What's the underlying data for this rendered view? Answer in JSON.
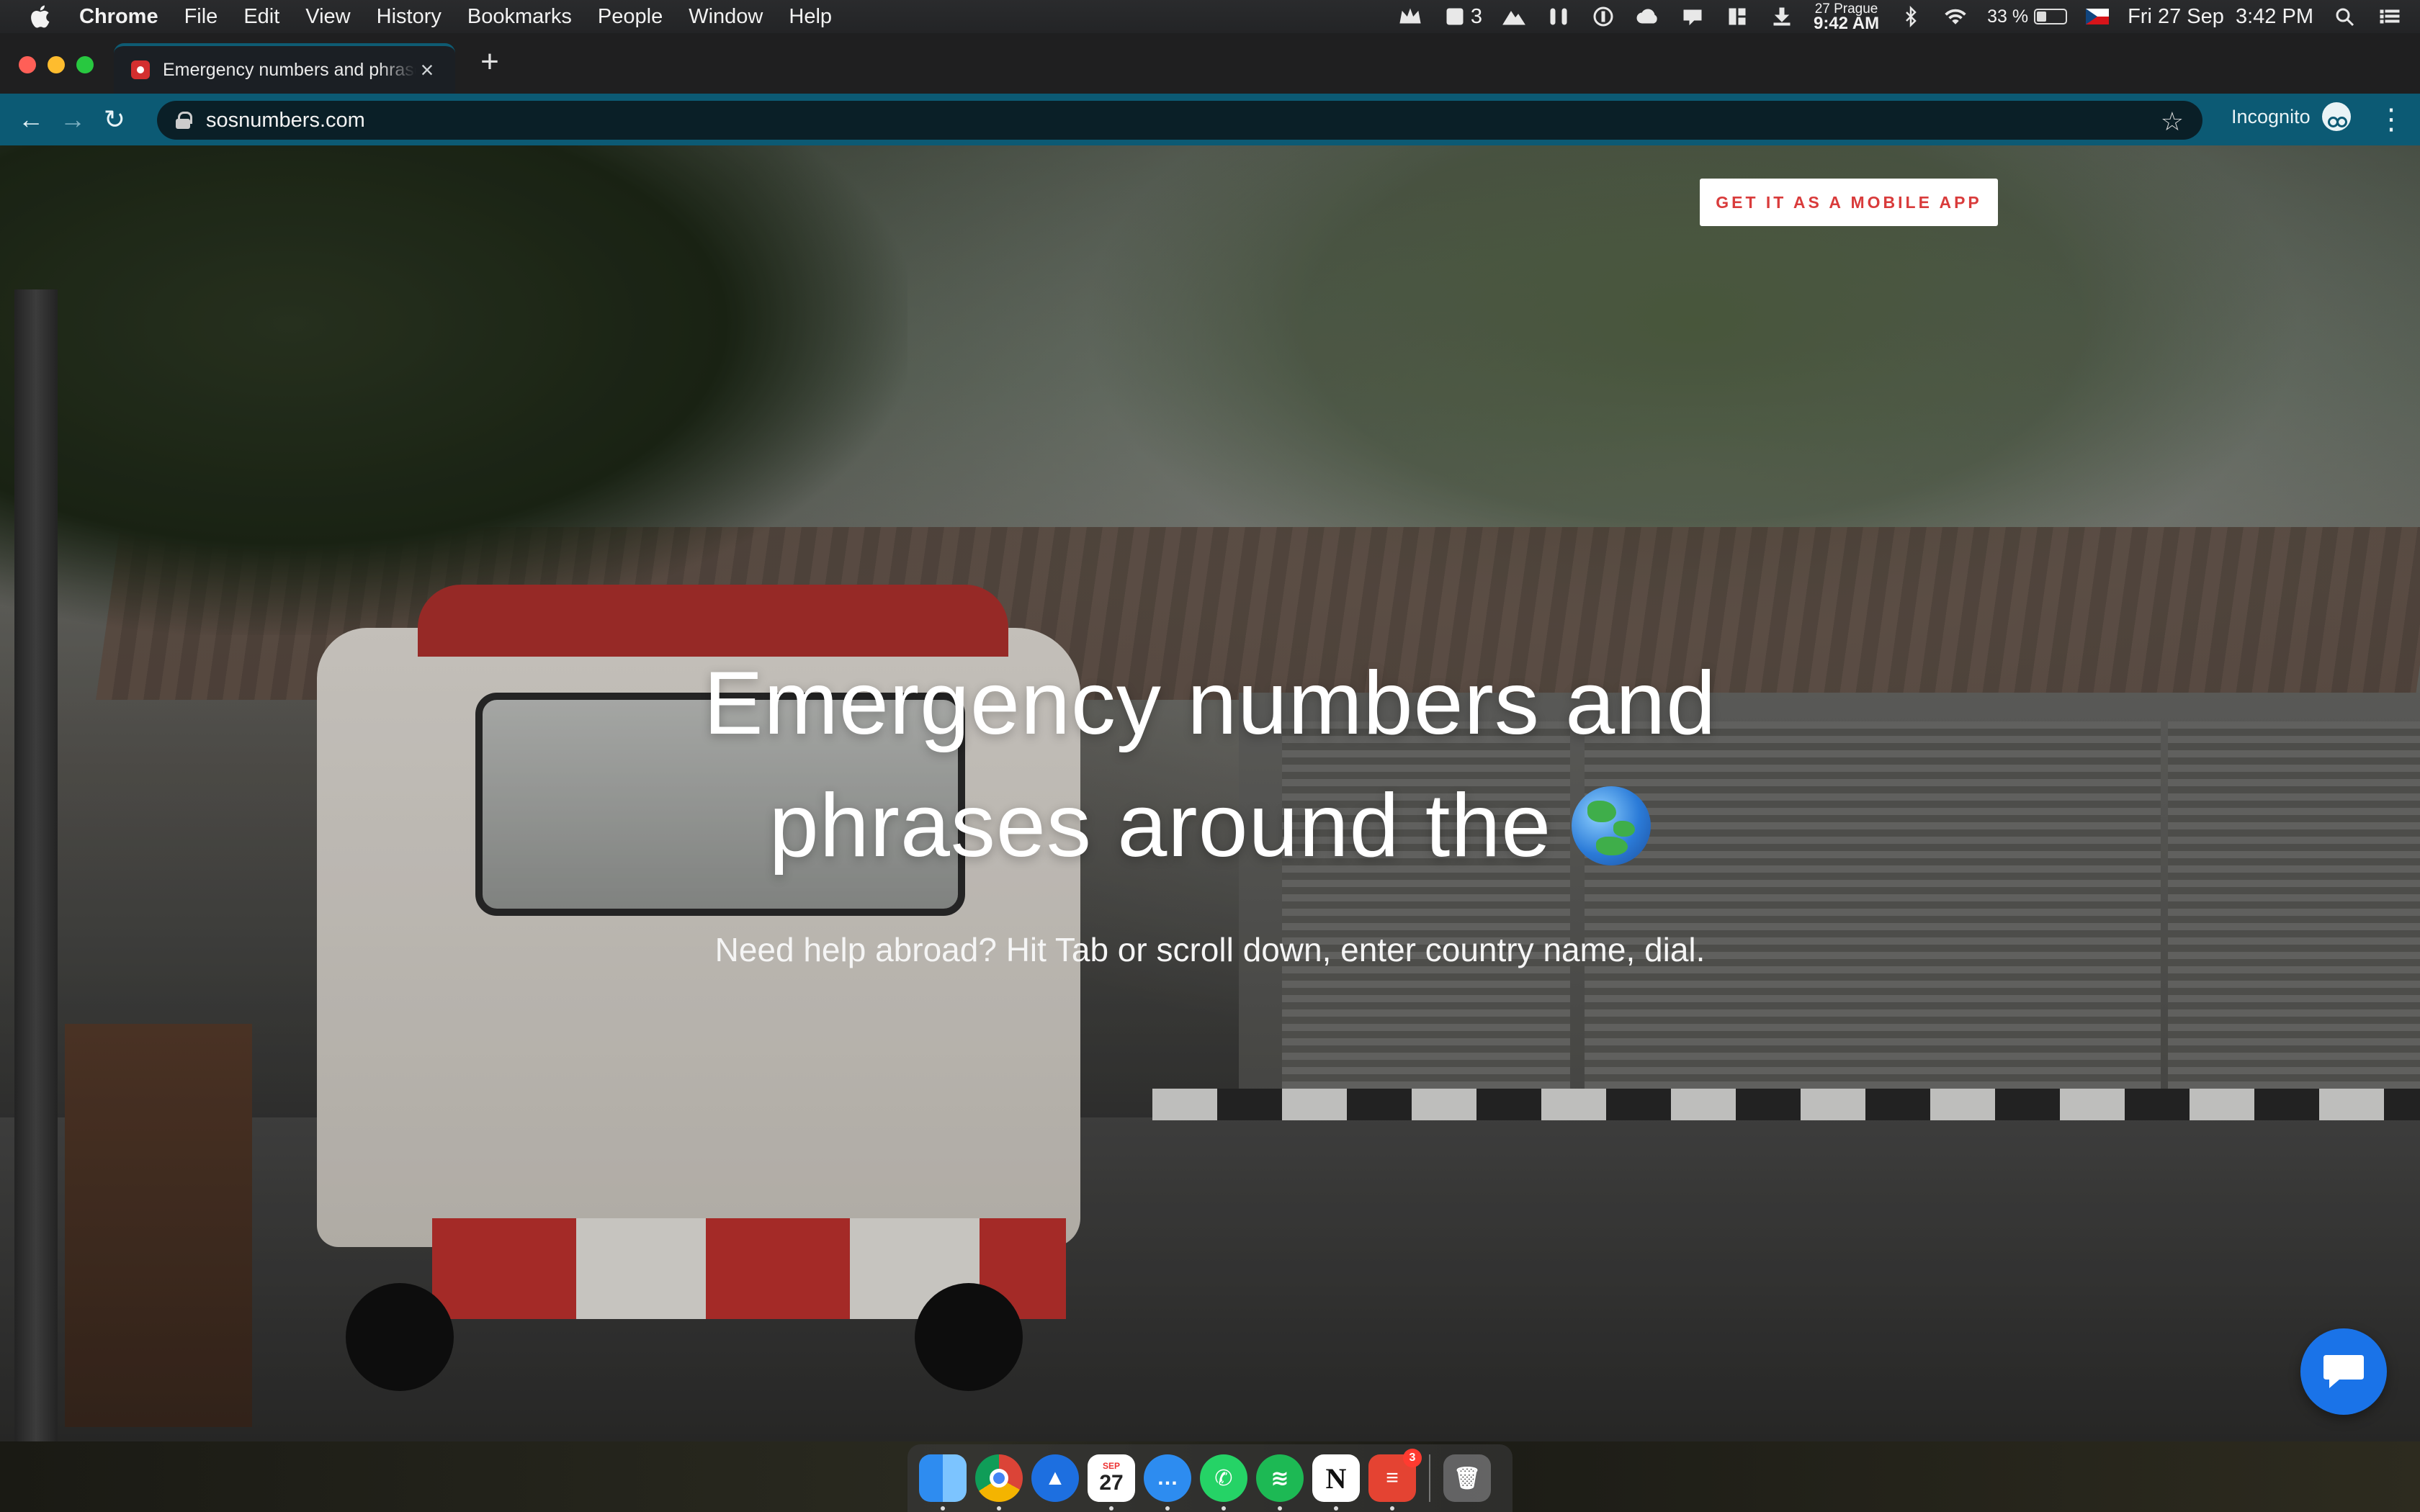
{
  "menubar": {
    "app": "Chrome",
    "items": [
      "File",
      "Edit",
      "View",
      "History",
      "Bookmarks",
      "People",
      "Window",
      "Help"
    ],
    "status": {
      "crown_count": "3",
      "world_clock_top": "27 Prague",
      "world_clock_bottom": "9:42 AM",
      "battery": "33 %",
      "battery_level": 0.33,
      "datetime": "Fri 27 Sep  3:42 PM"
    }
  },
  "browser": {
    "tab_title": "Emergency numbers and phrases around the world",
    "url": "sosnumbers.com",
    "profile_label": "Incognito"
  },
  "page": {
    "cta_label": "GET IT AS A MOBILE APP",
    "headline_line1": "Emergency numbers and",
    "headline_line2": "phrases around the",
    "subtitle": "Need help abroad? Hit Tab or scroll down, enter country name, dial."
  },
  "dock": {
    "calendar_month": "SEP",
    "calendar_day": "27",
    "notion_letter": "N",
    "todoist_badge": "3"
  },
  "colors": {
    "toolbar": "#0c5a74",
    "cta_text": "#d93b3b",
    "chat_button": "#1a73e8"
  }
}
